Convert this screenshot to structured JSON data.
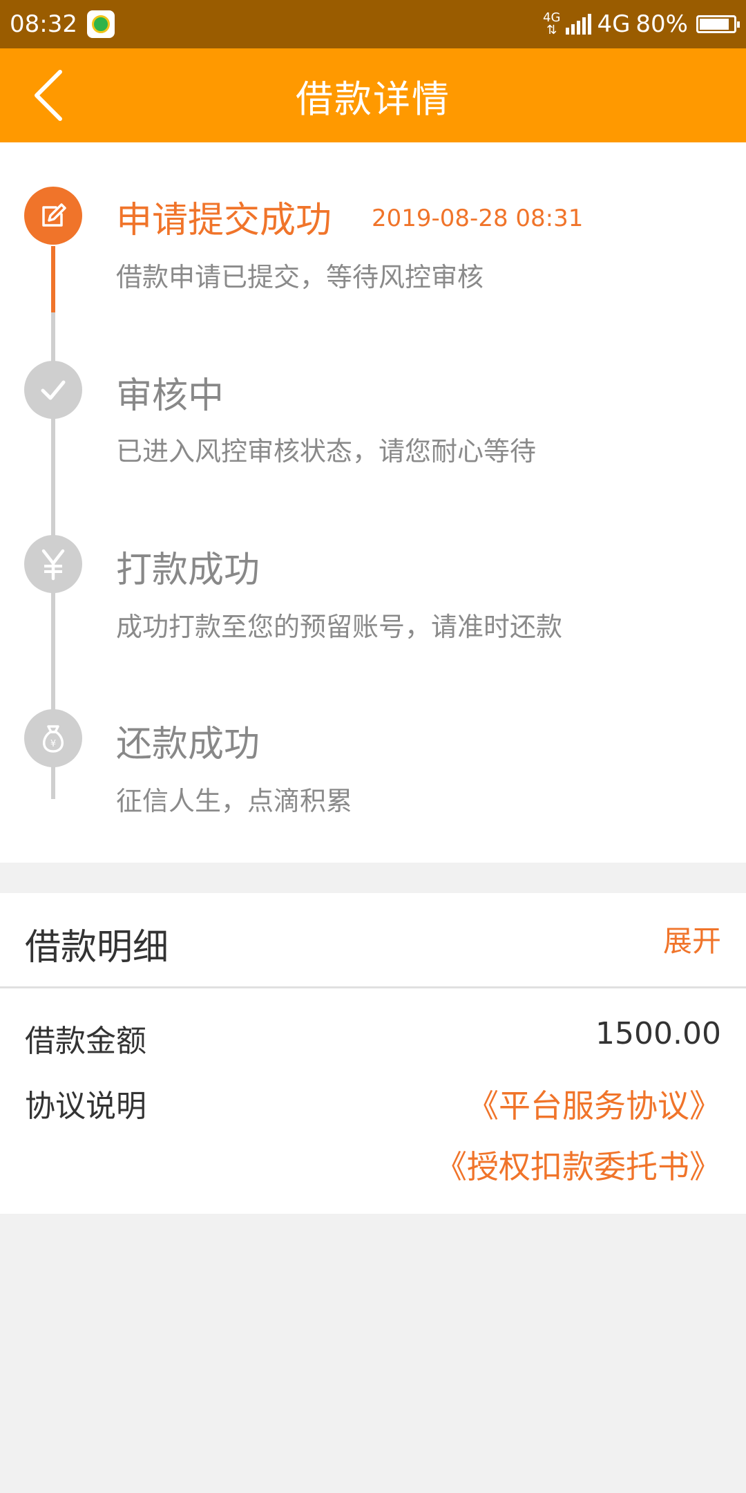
{
  "status_bar": {
    "time": "08:32",
    "network_small": "4G",
    "network": "4G",
    "battery": "80%",
    "battery_level": 0.8
  },
  "header": {
    "title": "借款详情",
    "back_icon": "chevron-left-icon"
  },
  "timeline": {
    "steps": [
      {
        "title": "申请提交成功",
        "time": "2019-08-28 08:31",
        "desc": "借款申请已提交，等待风控审核",
        "icon": "edit-icon",
        "active": true
      },
      {
        "title": "审核中",
        "desc": "已进入风控审核状态，请您耐心等待",
        "icon": "check-icon",
        "active": false
      },
      {
        "title": "打款成功",
        "desc": "成功打款至您的预留账号，请准时还款",
        "icon": "yen-icon",
        "active": false
      },
      {
        "title": "还款成功",
        "desc": "征信人生，点滴积累",
        "icon": "money-bag-icon",
        "active": false
      }
    ]
  },
  "detail": {
    "title": "借款明细",
    "expand_label": "展开",
    "amount_label": "借款金额",
    "amount_value": "1500.00",
    "agreement_label": "协议说明",
    "agreements": [
      "《平台服务协议》",
      "《授权扣款委托书》"
    ]
  },
  "colors": {
    "status_bar": "#9a5c00",
    "header": "#ff9900",
    "accent": "#f0742a",
    "inactive": "#cfcfcf"
  }
}
